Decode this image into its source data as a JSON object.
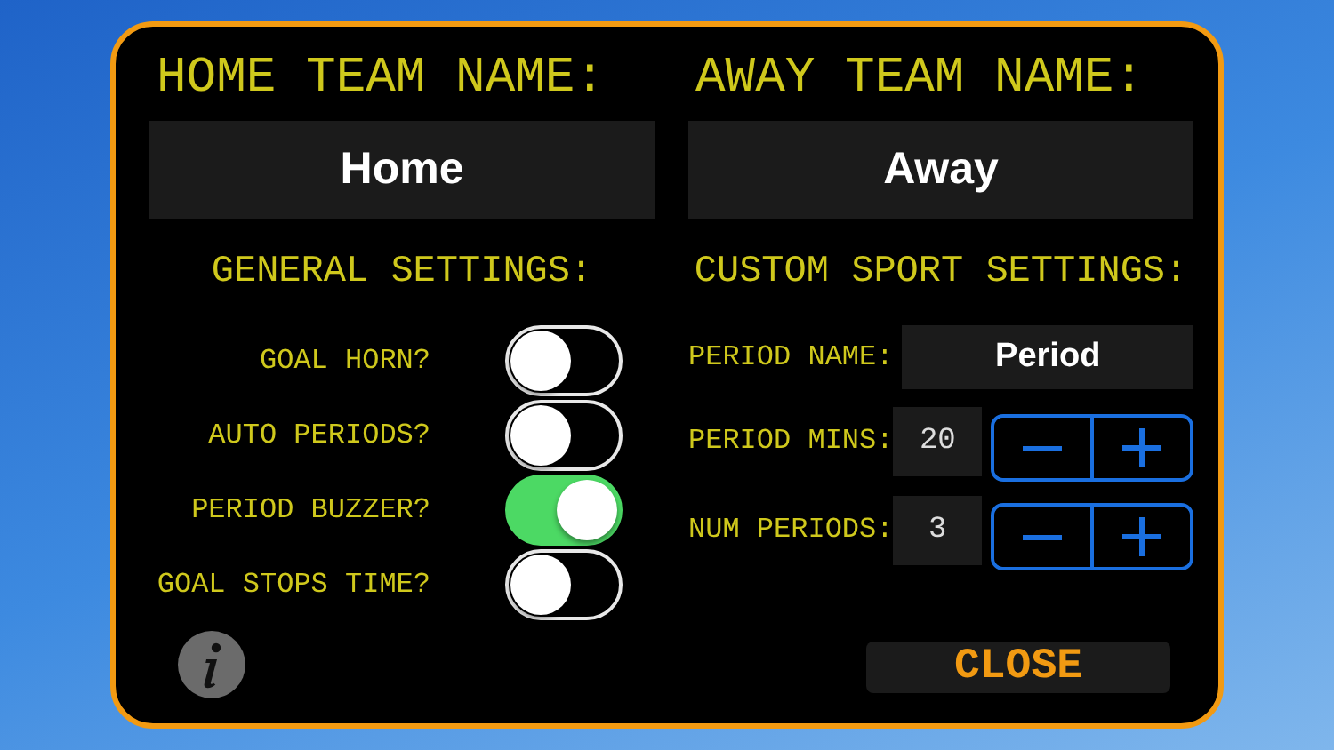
{
  "home_team": {
    "label": "HOME TEAM NAME:",
    "value": "Home"
  },
  "away_team": {
    "label": "AWAY TEAM NAME:",
    "value": "Away"
  },
  "general_settings": {
    "title": "GENERAL SETTINGS:",
    "toggles": [
      {
        "label": "GOAL HORN?",
        "on": false
      },
      {
        "label": "AUTO PERIODS?",
        "on": false
      },
      {
        "label": "PERIOD BUZZER?",
        "on": true
      },
      {
        "label": "GOAL STOPS TIME?",
        "on": false
      }
    ]
  },
  "custom_sport_settings": {
    "title": "CUSTOM SPORT SETTINGS:",
    "period_name": {
      "label": "PERIOD NAME:",
      "value": "Period"
    },
    "steppers": [
      {
        "label": "PERIOD MINS:",
        "value": "20"
      },
      {
        "label": "NUM PERIODS:",
        "value": "3"
      }
    ]
  },
  "close_button": "CLOSE"
}
